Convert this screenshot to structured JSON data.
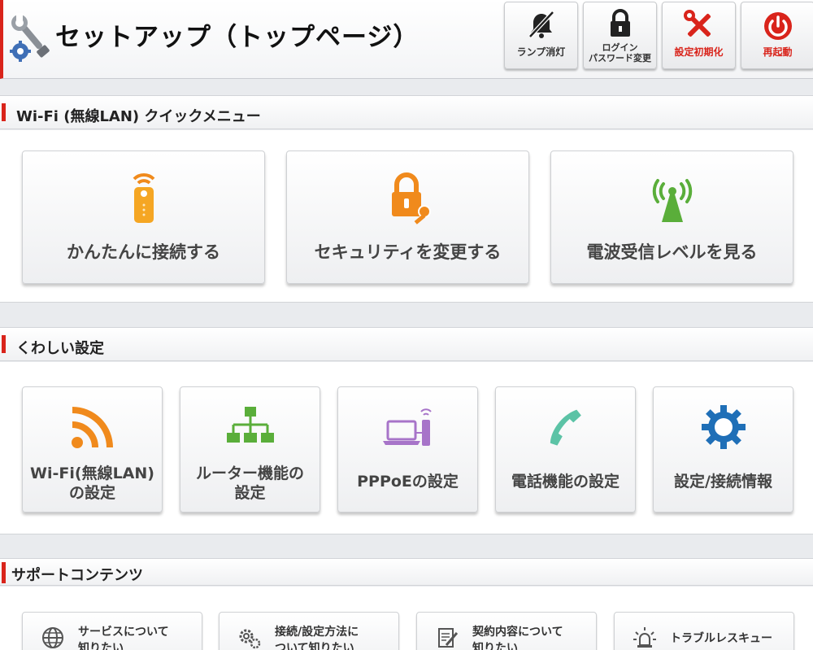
{
  "header": {
    "title": "セットアップ（トップページ）",
    "buttons": [
      {
        "label": "ランプ消灯",
        "label2": "",
        "icon": "lamp-off-icon"
      },
      {
        "label": "ログイン",
        "label2": "パスワード変更",
        "icon": "lock-icon"
      },
      {
        "label": "設定初期化",
        "label2": "",
        "icon": "tools-icon"
      },
      {
        "label": "再起動",
        "label2": "",
        "icon": "power-icon"
      }
    ]
  },
  "quick_menu": {
    "title": "Wi-Fi (無線LAN) クイックメニュー",
    "items": [
      {
        "label": "かんたんに接続する",
        "icon": "wps-device-icon"
      },
      {
        "label": "セキュリティを変更する",
        "icon": "lock-key-icon"
      },
      {
        "label": "電波受信レベルを見る",
        "icon": "antenna-icon"
      }
    ]
  },
  "detail_settings": {
    "title": "くわしい設定",
    "items": [
      {
        "line1": "Wi-Fi(無線LAN)",
        "line2": "の設定",
        "icon": "wifi-signal-icon"
      },
      {
        "line1": "ルーター機能の",
        "line2": "設定",
        "icon": "network-tree-icon"
      },
      {
        "line1": "PPPoEの設定",
        "line2": "",
        "icon": "laptop-router-icon"
      },
      {
        "line1": "電話機能の設定",
        "line2": "",
        "icon": "phone-icon"
      },
      {
        "line1": "設定/接続情報",
        "line2": "",
        "icon": "gear-icon"
      }
    ]
  },
  "support": {
    "title": "サポートコンテンツ",
    "items": [
      {
        "line1": "サービスについて",
        "line2": "知りたい",
        "icon": "globe-icon"
      },
      {
        "line1": "接続/設定方法に",
        "line2": "ついて知りたい",
        "icon": "gears-icon"
      },
      {
        "line1": "契約内容について",
        "line2": "知りたい",
        "icon": "document-edit-icon"
      },
      {
        "line1": "トラブルレスキュー",
        "line2": "",
        "icon": "alarm-light-icon"
      }
    ]
  },
  "colors": {
    "accent_red": "#d9241b",
    "orange": "#f08a1c",
    "green": "#5aae3a",
    "purple": "#a774c9",
    "teal": "#5cc3a6",
    "blue": "#1f6fb7"
  }
}
